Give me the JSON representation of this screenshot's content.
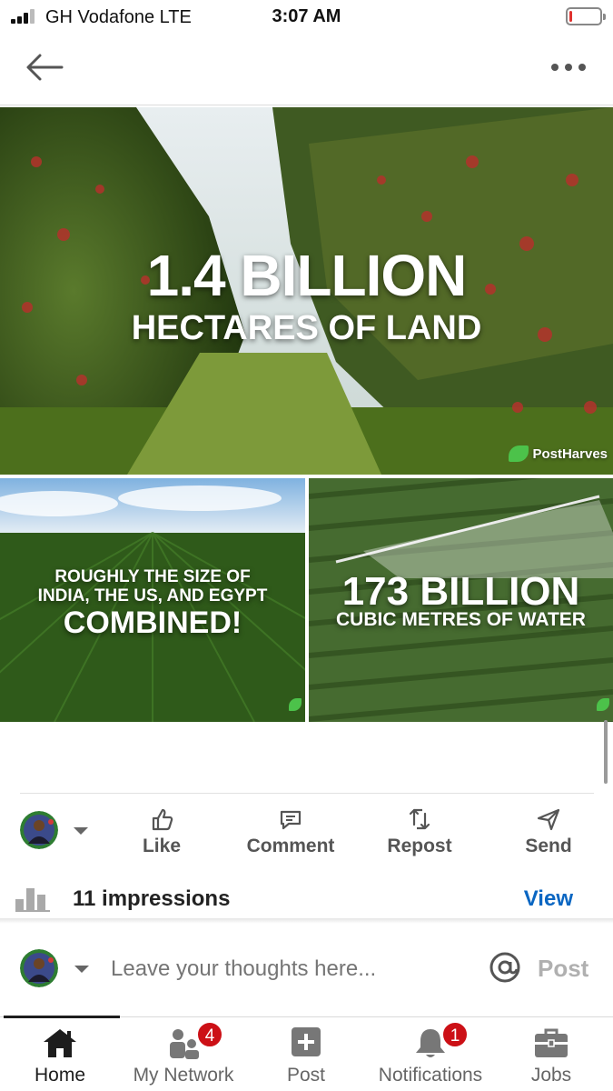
{
  "status_bar": {
    "carrier": "GH Vodafone  LTE",
    "time": "3:07 AM",
    "battery_level": 0.1
  },
  "nav": {
    "back_icon": "arrow-left-icon",
    "more_icon": "more-horizontal-icon"
  },
  "media": {
    "hero": {
      "line1": "1.4 BILLION",
      "line2": "HECTARES OF LAND",
      "watermark": "PostHarves"
    },
    "left": {
      "line1": "ROUGHLY THE SIZE OF",
      "line2": "INDIA, THE US, AND EGYPT",
      "line3": "COMBINED!"
    },
    "right": {
      "line1": "173 BILLION",
      "line2": "CUBIC METRES OF WATER"
    }
  },
  "actions": [
    {
      "label": "Like",
      "icon": "thumbs-up-icon"
    },
    {
      "label": "Comment",
      "icon": "comment-icon"
    },
    {
      "label": "Repost",
      "icon": "repost-icon"
    },
    {
      "label": "Send",
      "icon": "send-icon"
    }
  ],
  "impressions": {
    "text": "11 impressions",
    "link": "View"
  },
  "composer": {
    "placeholder": "Leave your thoughts here...",
    "mention_icon": "at-icon",
    "post_label": "Post"
  },
  "tabs": [
    {
      "label": "Home",
      "icon": "home-icon",
      "active": true
    },
    {
      "label": "My Network",
      "icon": "network-icon",
      "badge": "4"
    },
    {
      "label": "Post",
      "icon": "plus-square-icon"
    },
    {
      "label": "Notifications",
      "icon": "bell-icon",
      "badge": "1"
    },
    {
      "label": "Jobs",
      "icon": "briefcase-icon"
    }
  ],
  "colors": {
    "accent": "#0a66c2",
    "badge": "#cc1016",
    "battery_low": "#e0312e"
  }
}
